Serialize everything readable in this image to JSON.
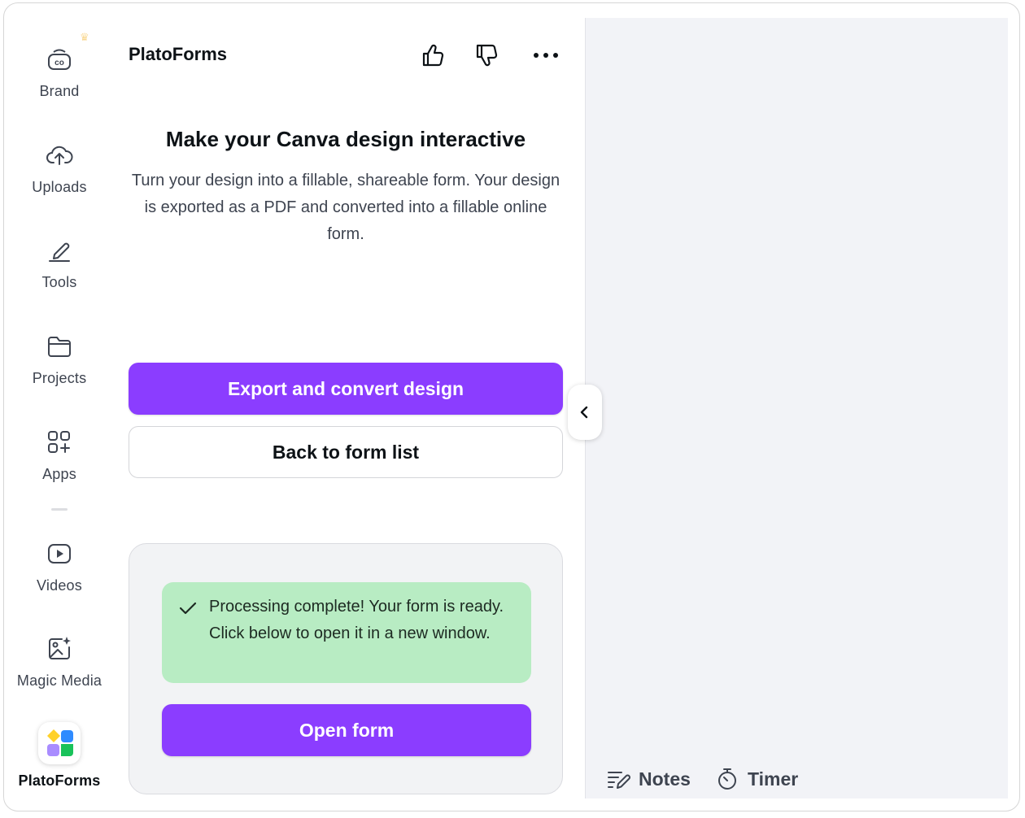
{
  "rail": {
    "items": [
      {
        "label": "Brand",
        "icon": "brand-icon"
      },
      {
        "label": "Uploads",
        "icon": "cloud-upload-icon"
      },
      {
        "label": "Tools",
        "icon": "pen-tool-icon"
      },
      {
        "label": "Projects",
        "icon": "folder-icon"
      },
      {
        "label": "Apps",
        "icon": "apps-grid-icon"
      },
      {
        "label": "Videos",
        "icon": "play-icon"
      },
      {
        "label": "Magic Media",
        "icon": "magic-image-icon"
      },
      {
        "label": "PlatoForms",
        "icon": "platoforms-logo-icon"
      }
    ]
  },
  "panel": {
    "title": "PlatoForms",
    "heading": "Make your Canva design interactive",
    "description": "Turn your design into a fillable, shareable form. Your design is exported as a PDF and converted into a fillable online form.",
    "export_button": "Export and convert design",
    "back_button": "Back to form list",
    "status_message": "Processing complete! Your form is ready. Click below to open it in a new window.",
    "open_button": "Open form"
  },
  "footer": {
    "notes_label": "Notes",
    "timer_label": "Timer"
  },
  "colors": {
    "accent": "#8b3dff",
    "success_bg": "#b8ecc3",
    "canvas_bg": "#f2f3f7"
  }
}
